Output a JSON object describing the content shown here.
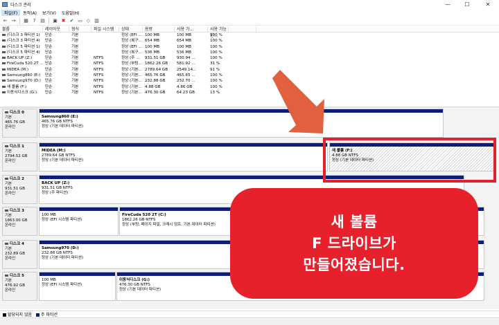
{
  "window": {
    "title": "디스크 관리",
    "minimize": "—",
    "maximize": "☐",
    "close": "✕"
  },
  "menu": [
    "파일(F)",
    "동작(A)",
    "보기(V)",
    "도움말(H)"
  ],
  "toolbar_icons": [
    "back-arrow-icon",
    "forward-arrow-icon",
    "grid-icon",
    "help-icon",
    "list-icon",
    "properties-icon",
    "delete-icon",
    "check-icon",
    "open-icon",
    "explore-icon",
    "view-icon"
  ],
  "volume_table": {
    "headers": [
      "볼륨",
      "레이아웃",
      "형식",
      "파일 시스템",
      "상태",
      "용량",
      "사용 가...",
      "사용 가능한...",
      ""
    ],
    "rows": [
      [
        "(디스크 3 파티션 1)",
        "단순",
        "기본",
        "",
        "정상 (EFI ...",
        "100 MB",
        "100 MB",
        "100 %"
      ],
      [
        "(디스크 3 파티션 4)",
        "단순",
        "기본",
        "",
        "정상 (복구...",
        "654 MB",
        "654 MB",
        "100 %"
      ],
      [
        "(디스크 5 파티션 1)",
        "단순",
        "기본",
        "",
        "정상 (EFI ...",
        "100 MB",
        "100 MB",
        "100 %"
      ],
      [
        "(디스크 5 파티션 4)",
        "단순",
        "기본",
        "",
        "정상 (복구...",
        "536 MB",
        "536 MB",
        "100 %"
      ],
      [
        "BACK UP (Z:)",
        "단순",
        "기본",
        "NTFS",
        "정상 (주 ...",
        "931.51 GB",
        "930.94 ...",
        "100 %"
      ],
      [
        "FireCuda 520 2T ...",
        "단순",
        "기본",
        "NTFS",
        "정상 (부팅...",
        "1862.26 GB",
        "581.92 ...",
        "31 %"
      ],
      [
        "MIDEA (M:)",
        "단순",
        "기본",
        "NTFS",
        "정상 (기본...",
        "2789.64 GB",
        "2549.14...",
        "91 %"
      ],
      [
        "Samsung860 (E:)",
        "단순",
        "기본",
        "NTFS",
        "정상 (기본...",
        "465.76 GB",
        "465.65 ...",
        "100 %"
      ],
      [
        "Samsung970 (D:)",
        "단순",
        "기본",
        "NTFS",
        "정상 (기본...",
        "232.88 GB",
        "232.70 ...",
        "100 %"
      ],
      [
        "새 볼륨 (F:)",
        "단순",
        "기본",
        "NTFS",
        "정상 (기본...",
        "4.88 GB",
        "4.86 GB",
        "100 %"
      ],
      [
        "이동식디스크 (G:)",
        "단순",
        "기본",
        "NTFS",
        "정상 (기본...",
        "476.30 GB",
        "64.23 GB",
        "13 %"
      ]
    ]
  },
  "disks": [
    {
      "name": "디스크 0",
      "type": "기본",
      "size": "465.76 GB",
      "status": "온라인",
      "partitions": [
        {
          "name": "Samsung860  (E:)",
          "size": "465.76 GB NTFS",
          "status": "정상 (기본 데이터 파티션)"
        }
      ]
    },
    {
      "name": "디스크 1",
      "type": "기본",
      "size": "2794.52 GB",
      "status": "온라인",
      "partitions": [
        {
          "name": "MIDEA  (M:)",
          "size": "2789.64 GB NTFS",
          "status": "정상 (기본 데이터 파티션)"
        },
        {
          "name": "새 볼륨  (F:)",
          "size": "4.88 GB NTFS",
          "status": "정상 (기본 데이터 파티션)"
        }
      ]
    },
    {
      "name": "디스크 2",
      "type": "기본",
      "size": "931.51 GB",
      "status": "온라인",
      "partitions": [
        {
          "name": "BACK UP  (Z:)",
          "size": "931.51 GB NTFS",
          "status": "정상 (주 파티션)"
        }
      ]
    },
    {
      "name": "디스크 3",
      "type": "기본",
      "size": "1863.00 GB",
      "status": "온라인",
      "partitions": [
        {
          "name": "",
          "size": "100 MB",
          "status": "정상 (EFI 시스템 파티션)"
        },
        {
          "name": "FireCuda 520 2T  (C:)",
          "size": "1862.26 GB NTFS",
          "status": "정상 (부팅, 페이지 파일, 크래시 덤프, 기본 데이터 파티션)"
        }
      ]
    },
    {
      "name": "디스크 4",
      "type": "기본",
      "size": "232.89 GB",
      "status": "온라인",
      "partitions": [
        {
          "name": "Samsung970  (D:)",
          "size": "232.88 GB NTFS",
          "status": "정상 (기본 데이터 파티션)"
        }
      ]
    },
    {
      "name": "디스크 5",
      "type": "기본",
      "size": "476.92 GB",
      "status": "온라인",
      "partitions": [
        {
          "name": "",
          "size": "100 MB",
          "status": "정상 (EFI 시스템 파티션)"
        },
        {
          "name": "이동식디스크  (G:)",
          "size": "476.30 GB NTFS",
          "status": "정상 (기본 데이터 파티션)"
        }
      ]
    }
  ],
  "legend": {
    "unallocated": "할당되지 않음",
    "primary": "주 파티션",
    "unallocated_color": "#111111",
    "primary_color": "#0b1f7a"
  },
  "callout": {
    "line1": "새 볼륨",
    "line2": "F 드라이브가",
    "line3": "만들어졌습니다.",
    "color": "#e7212b"
  }
}
